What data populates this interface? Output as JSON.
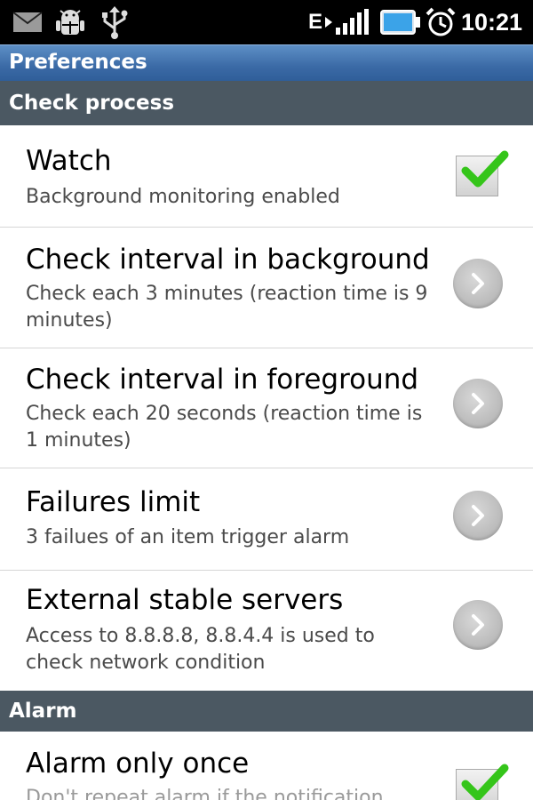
{
  "status_bar": {
    "time": "10:21",
    "network_type": "E",
    "icons": [
      "email-icon",
      "android-debug-icon",
      "usb-icon",
      "signal-icon",
      "battery-icon",
      "alarm-clock-icon"
    ]
  },
  "title_bar": {
    "title": "Preferences"
  },
  "categories": {
    "check_process": "Check process",
    "alarm": "Alarm"
  },
  "prefs": [
    {
      "title": "Watch",
      "summary": "Background monitoring enabled",
      "widget": "checkbox",
      "checked": true
    },
    {
      "title": "Check interval in background",
      "summary": "Check each 3 minutes (reaction time is 9 minutes)",
      "widget": "chevron"
    },
    {
      "title": "Check interval in foreground",
      "summary": "Check each 20 seconds (reaction time is 1 minutes)",
      "widget": "chevron"
    },
    {
      "title": "Failures limit",
      "summary": "3 failues of an item trigger alarm",
      "widget": "chevron"
    },
    {
      "title": "External stable servers",
      "summary": "Access to 8.8.8.8, 8.8.4.4 is used to check network condition",
      "widget": "chevron"
    },
    {
      "title": "Alarm only once",
      "summary": "Don't repeat alarm if the notification",
      "widget": "checkbox",
      "checked": true
    }
  ],
  "colors": {
    "title_bar": "#3b6aa6",
    "category_bar": "#4b5862",
    "check_green": "#35c51a"
  }
}
